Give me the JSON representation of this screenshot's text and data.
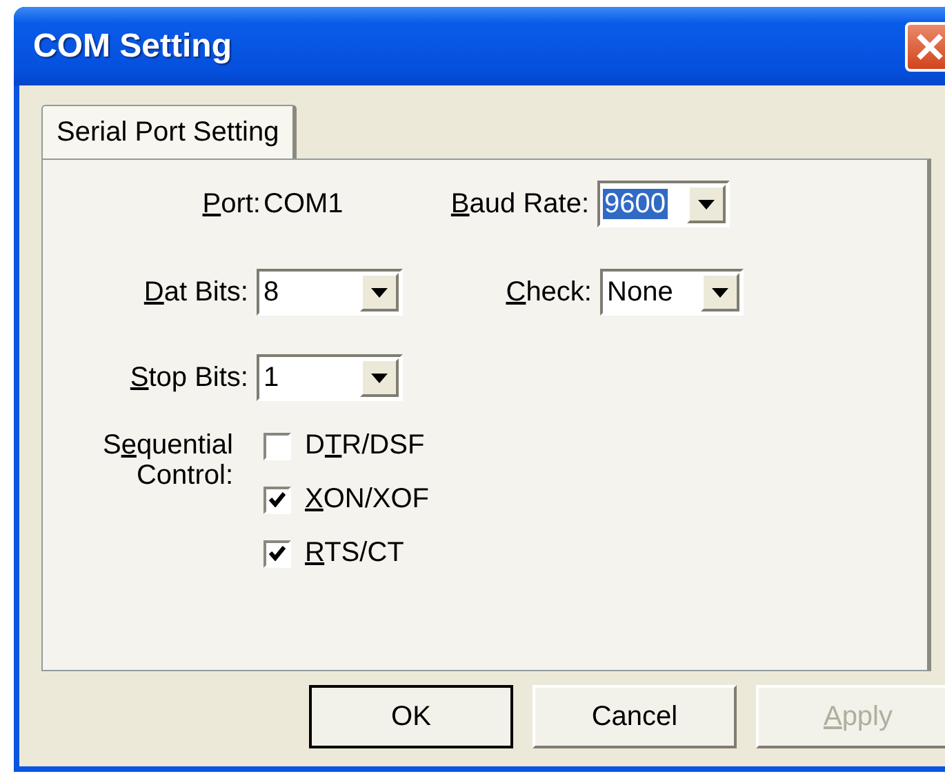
{
  "window": {
    "title": "COM Setting"
  },
  "tabs": [
    {
      "label": "Serial Port Setting",
      "selected": true
    }
  ],
  "port": {
    "label": {
      "key": "P",
      "after": "ort:"
    },
    "value": "COM1"
  },
  "baud_rate": {
    "label": {
      "key": "B",
      "after": "aud Rate:"
    },
    "value": "9600",
    "focused": true
  },
  "data_bits": {
    "label": {
      "key": "D",
      "after": "at Bits:"
    },
    "value": "8",
    "focused": false
  },
  "check": {
    "label": {
      "key": "C",
      "after": "heck:"
    },
    "value": "None",
    "focused": false
  },
  "stop_bits": {
    "label": {
      "key": "S",
      "after": "top Bits:"
    },
    "value": "1",
    "focused": false
  },
  "sequential_control": {
    "label_lines": [
      {
        "before": "S",
        "key": "e",
        "after": "quential"
      },
      {
        "before": "Control:"
      }
    ],
    "options": [
      {
        "label": {
          "before": "D",
          "key": "T",
          "after": "R/DSF"
        },
        "checked": false
      },
      {
        "label": {
          "key": "X",
          "after": "ON/XOF"
        },
        "checked": true
      },
      {
        "label": {
          "key": "R",
          "after": "TS/CT"
        },
        "checked": true
      }
    ]
  },
  "buttons": [
    {
      "label": {
        "before": "OK"
      },
      "default": true,
      "disabled": false
    },
    {
      "label": {
        "before": "Cancel"
      },
      "default": false,
      "disabled": false
    },
    {
      "label": {
        "key": "A",
        "after": "pply"
      },
      "default": false,
      "disabled": true
    }
  ]
}
